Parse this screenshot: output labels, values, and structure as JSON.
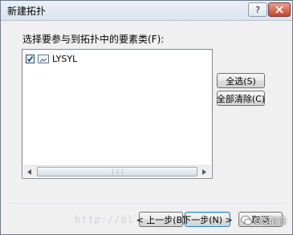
{
  "window": {
    "title": "新建拓扑",
    "help_label": "?",
    "close_label": "x"
  },
  "prompt": "选择要参与到拓扑中的要素类(F):",
  "list": {
    "items": [
      {
        "label": "LYSYL",
        "checked": true,
        "icon": "feature-class-icon"
      }
    ]
  },
  "buttons": {
    "select_all": "全选(S)",
    "clear_all": "全部清除(C)",
    "back": "< 上一步(B)",
    "next": "下一步(N) >",
    "cancel": "取消"
  },
  "watermark": {
    "text": "http://bl",
    "badge": "GIS前沿"
  },
  "colors": {
    "dialog_bg": "#f0f0f0",
    "titlebar": "#dbe4ef",
    "close_button": "#c4442e",
    "default_button_border": "#3c7fb1"
  }
}
